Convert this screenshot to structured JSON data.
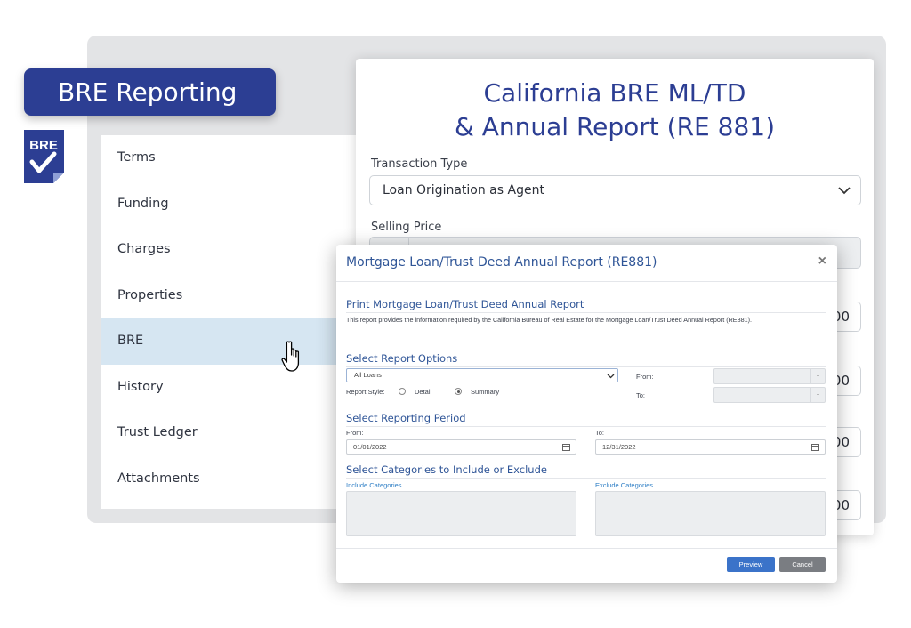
{
  "banner": {
    "title": "BRE Reporting",
    "icon_label": "BRE"
  },
  "sidebar": {
    "items": [
      {
        "label": "Terms"
      },
      {
        "label": "Funding"
      },
      {
        "label": "Charges"
      },
      {
        "label": "Properties"
      },
      {
        "label": "BRE",
        "active": true
      },
      {
        "label": "History"
      },
      {
        "label": "Trust Ledger"
      },
      {
        "label": "Attachments"
      }
    ]
  },
  "card": {
    "title_line1": "California BRE ML/TD",
    "title_line2": "& Annual Report (RE 881)",
    "transaction_type_label": "Transaction Type",
    "transaction_type_value": "Loan Origination as Agent",
    "selling_price_label": "Selling Price",
    "amount_suffixes": [
      "00",
      "00",
      "00",
      "00"
    ]
  },
  "modal": {
    "title": "Mortgage Loan/Trust Deed Annual Report (RE881)",
    "close": "×",
    "print_heading": "Print Mortgage Loan/Trust Deed Annual Report",
    "description": "This report provides the information required by the California Bureau of Real Estate for the Mortgage Loan/Trust Deed Annual Report (RE881).",
    "options_heading": "Select Report Options",
    "loans_select_value": "All Loans",
    "report_style_label": "Report Style:",
    "style_detail": "Detail",
    "style_summary": "Summary",
    "selected_style": "Summary",
    "from_label": "From:",
    "to_label": "To:",
    "period_heading": "Select Reporting Period",
    "period_from_label": "From:",
    "period_to_label": "To:",
    "period_from_value": "01/01/2022",
    "period_to_value": "12/31/2022",
    "categories_heading": "Select Categories to Include or Exclude",
    "include_label": "Include Categories",
    "exclude_label": "Exclude Categories",
    "preview_button": "Preview",
    "cancel_button": "Cancel"
  },
  "colors": {
    "brand": "#2c3e93",
    "active_row": "#d6e6f2",
    "link_blue": "#2f5597",
    "preview": "#3b73c9",
    "cancel": "#7a7d82"
  }
}
